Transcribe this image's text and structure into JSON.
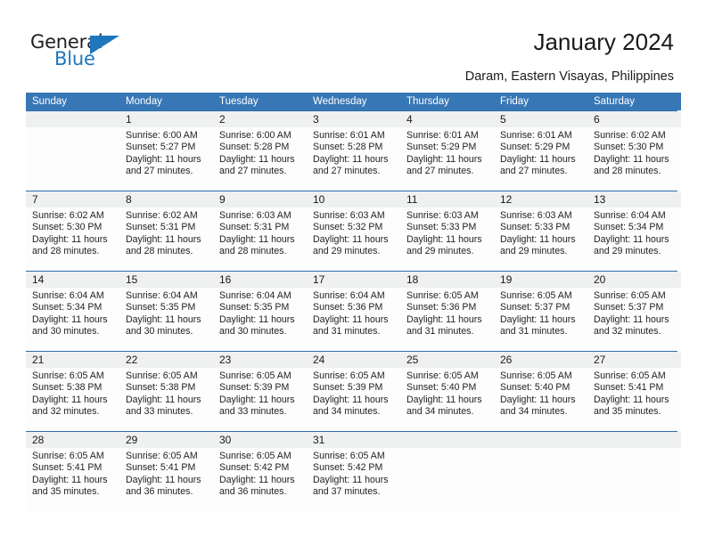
{
  "brand": {
    "name_part1": "General",
    "name_part2": "Blue",
    "triangle_icon": "triangle-icon",
    "accent_color": "#1f76bc"
  },
  "header": {
    "title": "January 2024",
    "subtitle": "Daram, Eastern Visayas, Philippines"
  },
  "theme": {
    "header_blue": "#3877b5",
    "rule_blue": "#2f6fad",
    "daynum_band": "#eff0f0",
    "cell_bg": "#fdfdfd"
  },
  "weekdays": [
    "Sunday",
    "Monday",
    "Tuesday",
    "Wednesday",
    "Thursday",
    "Friday",
    "Saturday"
  ],
  "weeks": [
    [
      {
        "day": "",
        "sunrise": "",
        "sunset": "",
        "daylight_line1": "",
        "daylight_line2": ""
      },
      {
        "day": "1",
        "sunrise": "Sunrise: 6:00 AM",
        "sunset": "Sunset: 5:27 PM",
        "daylight_line1": "Daylight: 11 hours",
        "daylight_line2": "and 27 minutes."
      },
      {
        "day": "2",
        "sunrise": "Sunrise: 6:00 AM",
        "sunset": "Sunset: 5:28 PM",
        "daylight_line1": "Daylight: 11 hours",
        "daylight_line2": "and 27 minutes."
      },
      {
        "day": "3",
        "sunrise": "Sunrise: 6:01 AM",
        "sunset": "Sunset: 5:28 PM",
        "daylight_line1": "Daylight: 11 hours",
        "daylight_line2": "and 27 minutes."
      },
      {
        "day": "4",
        "sunrise": "Sunrise: 6:01 AM",
        "sunset": "Sunset: 5:29 PM",
        "daylight_line1": "Daylight: 11 hours",
        "daylight_line2": "and 27 minutes."
      },
      {
        "day": "5",
        "sunrise": "Sunrise: 6:01 AM",
        "sunset": "Sunset: 5:29 PM",
        "daylight_line1": "Daylight: 11 hours",
        "daylight_line2": "and 27 minutes."
      },
      {
        "day": "6",
        "sunrise": "Sunrise: 6:02 AM",
        "sunset": "Sunset: 5:30 PM",
        "daylight_line1": "Daylight: 11 hours",
        "daylight_line2": "and 28 minutes."
      }
    ],
    [
      {
        "day": "7",
        "sunrise": "Sunrise: 6:02 AM",
        "sunset": "Sunset: 5:30 PM",
        "daylight_line1": "Daylight: 11 hours",
        "daylight_line2": "and 28 minutes."
      },
      {
        "day": "8",
        "sunrise": "Sunrise: 6:02 AM",
        "sunset": "Sunset: 5:31 PM",
        "daylight_line1": "Daylight: 11 hours",
        "daylight_line2": "and 28 minutes."
      },
      {
        "day": "9",
        "sunrise": "Sunrise: 6:03 AM",
        "sunset": "Sunset: 5:31 PM",
        "daylight_line1": "Daylight: 11 hours",
        "daylight_line2": "and 28 minutes."
      },
      {
        "day": "10",
        "sunrise": "Sunrise: 6:03 AM",
        "sunset": "Sunset: 5:32 PM",
        "daylight_line1": "Daylight: 11 hours",
        "daylight_line2": "and 29 minutes."
      },
      {
        "day": "11",
        "sunrise": "Sunrise: 6:03 AM",
        "sunset": "Sunset: 5:33 PM",
        "daylight_line1": "Daylight: 11 hours",
        "daylight_line2": "and 29 minutes."
      },
      {
        "day": "12",
        "sunrise": "Sunrise: 6:03 AM",
        "sunset": "Sunset: 5:33 PM",
        "daylight_line1": "Daylight: 11 hours",
        "daylight_line2": "and 29 minutes."
      },
      {
        "day": "13",
        "sunrise": "Sunrise: 6:04 AM",
        "sunset": "Sunset: 5:34 PM",
        "daylight_line1": "Daylight: 11 hours",
        "daylight_line2": "and 29 minutes."
      }
    ],
    [
      {
        "day": "14",
        "sunrise": "Sunrise: 6:04 AM",
        "sunset": "Sunset: 5:34 PM",
        "daylight_line1": "Daylight: 11 hours",
        "daylight_line2": "and 30 minutes."
      },
      {
        "day": "15",
        "sunrise": "Sunrise: 6:04 AM",
        "sunset": "Sunset: 5:35 PM",
        "daylight_line1": "Daylight: 11 hours",
        "daylight_line2": "and 30 minutes."
      },
      {
        "day": "16",
        "sunrise": "Sunrise: 6:04 AM",
        "sunset": "Sunset: 5:35 PM",
        "daylight_line1": "Daylight: 11 hours",
        "daylight_line2": "and 30 minutes."
      },
      {
        "day": "17",
        "sunrise": "Sunrise: 6:04 AM",
        "sunset": "Sunset: 5:36 PM",
        "daylight_line1": "Daylight: 11 hours",
        "daylight_line2": "and 31 minutes."
      },
      {
        "day": "18",
        "sunrise": "Sunrise: 6:05 AM",
        "sunset": "Sunset: 5:36 PM",
        "daylight_line1": "Daylight: 11 hours",
        "daylight_line2": "and 31 minutes."
      },
      {
        "day": "19",
        "sunrise": "Sunrise: 6:05 AM",
        "sunset": "Sunset: 5:37 PM",
        "daylight_line1": "Daylight: 11 hours",
        "daylight_line2": "and 31 minutes."
      },
      {
        "day": "20",
        "sunrise": "Sunrise: 6:05 AM",
        "sunset": "Sunset: 5:37 PM",
        "daylight_line1": "Daylight: 11 hours",
        "daylight_line2": "and 32 minutes."
      }
    ],
    [
      {
        "day": "21",
        "sunrise": "Sunrise: 6:05 AM",
        "sunset": "Sunset: 5:38 PM",
        "daylight_line1": "Daylight: 11 hours",
        "daylight_line2": "and 32 minutes."
      },
      {
        "day": "22",
        "sunrise": "Sunrise: 6:05 AM",
        "sunset": "Sunset: 5:38 PM",
        "daylight_line1": "Daylight: 11 hours",
        "daylight_line2": "and 33 minutes."
      },
      {
        "day": "23",
        "sunrise": "Sunrise: 6:05 AM",
        "sunset": "Sunset: 5:39 PM",
        "daylight_line1": "Daylight: 11 hours",
        "daylight_line2": "and 33 minutes."
      },
      {
        "day": "24",
        "sunrise": "Sunrise: 6:05 AM",
        "sunset": "Sunset: 5:39 PM",
        "daylight_line1": "Daylight: 11 hours",
        "daylight_line2": "and 34 minutes."
      },
      {
        "day": "25",
        "sunrise": "Sunrise: 6:05 AM",
        "sunset": "Sunset: 5:40 PM",
        "daylight_line1": "Daylight: 11 hours",
        "daylight_line2": "and 34 minutes."
      },
      {
        "day": "26",
        "sunrise": "Sunrise: 6:05 AM",
        "sunset": "Sunset: 5:40 PM",
        "daylight_line1": "Daylight: 11 hours",
        "daylight_line2": "and 34 minutes."
      },
      {
        "day": "27",
        "sunrise": "Sunrise: 6:05 AM",
        "sunset": "Sunset: 5:41 PM",
        "daylight_line1": "Daylight: 11 hours",
        "daylight_line2": "and 35 minutes."
      }
    ],
    [
      {
        "day": "28",
        "sunrise": "Sunrise: 6:05 AM",
        "sunset": "Sunset: 5:41 PM",
        "daylight_line1": "Daylight: 11 hours",
        "daylight_line2": "and 35 minutes."
      },
      {
        "day": "29",
        "sunrise": "Sunrise: 6:05 AM",
        "sunset": "Sunset: 5:41 PM",
        "daylight_line1": "Daylight: 11 hours",
        "daylight_line2": "and 36 minutes."
      },
      {
        "day": "30",
        "sunrise": "Sunrise: 6:05 AM",
        "sunset": "Sunset: 5:42 PM",
        "daylight_line1": "Daylight: 11 hours",
        "daylight_line2": "and 36 minutes."
      },
      {
        "day": "31",
        "sunrise": "Sunrise: 6:05 AM",
        "sunset": "Sunset: 5:42 PM",
        "daylight_line1": "Daylight: 11 hours",
        "daylight_line2": "and 37 minutes."
      },
      {
        "day": "",
        "sunrise": "",
        "sunset": "",
        "daylight_line1": "",
        "daylight_line2": ""
      },
      {
        "day": "",
        "sunrise": "",
        "sunset": "",
        "daylight_line1": "",
        "daylight_line2": ""
      },
      {
        "day": "",
        "sunrise": "",
        "sunset": "",
        "daylight_line1": "",
        "daylight_line2": ""
      }
    ]
  ]
}
